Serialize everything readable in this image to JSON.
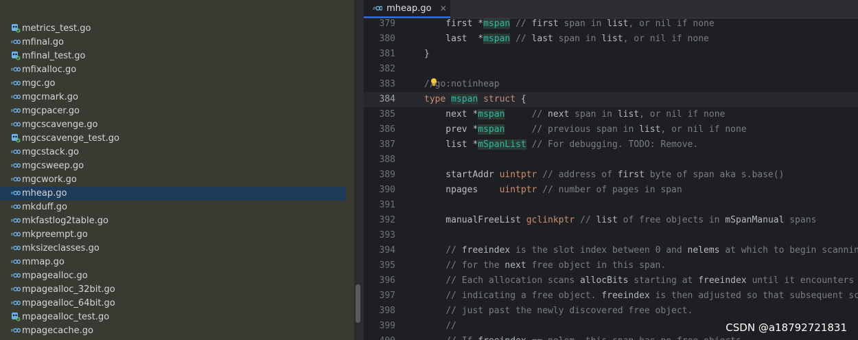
{
  "sidebar": {
    "files": [
      {
        "name": "metrics_test.go",
        "kind": "test"
      },
      {
        "name": "mfinal.go",
        "kind": "go"
      },
      {
        "name": "mfinal_test.go",
        "kind": "test"
      },
      {
        "name": "mfixalloc.go",
        "kind": "go"
      },
      {
        "name": "mgc.go",
        "kind": "go"
      },
      {
        "name": "mgcmark.go",
        "kind": "go"
      },
      {
        "name": "mgcpacer.go",
        "kind": "go"
      },
      {
        "name": "mgcscavenge.go",
        "kind": "go"
      },
      {
        "name": "mgcscavenge_test.go",
        "kind": "test"
      },
      {
        "name": "mgcstack.go",
        "kind": "go"
      },
      {
        "name": "mgcsweep.go",
        "kind": "go"
      },
      {
        "name": "mgcwork.go",
        "kind": "go"
      },
      {
        "name": "mheap.go",
        "kind": "go",
        "selected": true
      },
      {
        "name": "mkduff.go",
        "kind": "go"
      },
      {
        "name": "mkfastlog2table.go",
        "kind": "go"
      },
      {
        "name": "mkpreempt.go",
        "kind": "go"
      },
      {
        "name": "mksizeclasses.go",
        "kind": "go"
      },
      {
        "name": "mmap.go",
        "kind": "go"
      },
      {
        "name": "mpagealloc.go",
        "kind": "go"
      },
      {
        "name": "mpagealloc_32bit.go",
        "kind": "go"
      },
      {
        "name": "mpagealloc_64bit.go",
        "kind": "go"
      },
      {
        "name": "mpagealloc_test.go",
        "kind": "test"
      },
      {
        "name": "mpagecache.go",
        "kind": "go"
      }
    ]
  },
  "editor": {
    "tab": {
      "label": "mheap.go",
      "close": "×"
    },
    "current_line": "384",
    "lines": [
      {
        "no": "379",
        "code": "    first *mspan // first span in list, or nil if none"
      },
      {
        "no": "380",
        "code": "    last  *mspan // last span in list, or nil if none"
      },
      {
        "no": "381",
        "code": "}"
      },
      {
        "no": "382",
        "code": ""
      },
      {
        "no": "383",
        "code": "//go:notinheap"
      },
      {
        "no": "384",
        "code": "type mspan struct {"
      },
      {
        "no": "385",
        "code": "    next *mspan     // next span in list, or nil if none"
      },
      {
        "no": "386",
        "code": "    prev *mspan     // previous span in list, or nil if none"
      },
      {
        "no": "387",
        "code": "    list *mSpanList // For debugging. TODO: Remove."
      },
      {
        "no": "388",
        "code": ""
      },
      {
        "no": "389",
        "code": "    startAddr uintptr // address of first byte of span aka s.base()"
      },
      {
        "no": "390",
        "code": "    npages    uintptr // number of pages in span"
      },
      {
        "no": "391",
        "code": ""
      },
      {
        "no": "392",
        "code": "    manualFreeList gclinkptr // list of free objects in mSpanManual spans"
      },
      {
        "no": "393",
        "code": ""
      },
      {
        "no": "394",
        "code": "    // freeindex is the slot index between 0 and nelems at which to begin scannin"
      },
      {
        "no": "395",
        "code": "    // for the next free object in this span."
      },
      {
        "no": "396",
        "code": "    // Each allocation scans allocBits starting at freeindex until it encounters"
      },
      {
        "no": "397",
        "code": "    // indicating a free object. freeindex is then adjusted so that subsequent sc"
      },
      {
        "no": "398",
        "code": "    // just past the newly discovered free object."
      },
      {
        "no": "399",
        "code": "    //"
      },
      {
        "no": "400",
        "code": "    // If freeindex == nelem, this span has no free objects."
      }
    ]
  },
  "watermark": "CSDN @a18792721831",
  "colors": {
    "keyword": "#cf8e6d",
    "type": "#2fbaa3",
    "comment": "#7a7e85",
    "selection": "#1d3c5c",
    "tab_accent": "#3574f0"
  }
}
